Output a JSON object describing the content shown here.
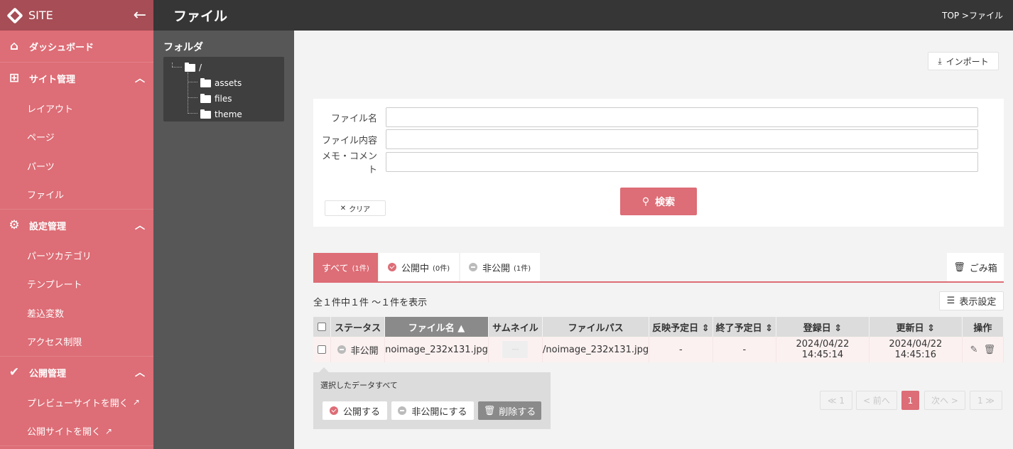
{
  "brand": {
    "name": "SITE"
  },
  "topbar": {
    "title": "ファイル",
    "breadcrumb": "TOP >ファイル"
  },
  "sidebar": {
    "dashboard": "ダッシュボード",
    "site_mgmt": {
      "label": "サイト管理",
      "items": [
        "レイアウト",
        "ページ",
        "パーツ",
        "ファイル"
      ]
    },
    "settings_mgmt": {
      "label": "設定管理",
      "items": [
        "パーツカテゴリ",
        "テンプレート",
        "差込変数",
        "アクセス制限"
      ]
    },
    "publish_mgmt": {
      "label": "公開管理",
      "items": [
        "プレビューサイトを開く",
        "公開サイトを開く"
      ]
    }
  },
  "folders": {
    "title": "フォルダ",
    "root": "/",
    "children": [
      "assets",
      "files",
      "theme"
    ]
  },
  "import_label": "インポート",
  "search": {
    "fields": [
      "ファイル名",
      "ファイル内容",
      "メモ・コメント"
    ],
    "clear": "クリア",
    "submit": "検索"
  },
  "tabs": [
    {
      "label": "すべて",
      "count": "(1件)"
    },
    {
      "label": "公開中",
      "count": "(0件)"
    },
    {
      "label": "非公開",
      "count": "(1件)"
    }
  ],
  "trash_label": "ごみ箱",
  "count_text": "全１件中１件 〜１件を表示",
  "display_settings": "表示設定",
  "table": {
    "headers": [
      "ステータス",
      "ファイル名",
      "サムネイル",
      "ファイルパス",
      "反映予定日",
      "終了予定日",
      "登録日",
      "更新日",
      "操作"
    ],
    "rows": [
      {
        "status": "非公開",
        "name": "noimage_232x131.jpg",
        "thumb": "---",
        "path": "/noimage_232x131.jpg",
        "publish_at": "-",
        "end_at": "-",
        "created": "2024/04/22 14:45:14",
        "updated": "2024/04/22 14:45:16"
      }
    ]
  },
  "bulk": {
    "label": "選択したデータすべて",
    "publish": "公開する",
    "unpublish": "非公開にする",
    "delete": "削除する"
  },
  "pagination": {
    "first": "≪ 1",
    "prev": "< 前へ",
    "current": "1",
    "next": "次へ >",
    "last": "1 ≫"
  },
  "colors": {
    "accent": "#dd6d76",
    "sidebar": "#dd6d76",
    "topbar": "#363636"
  }
}
